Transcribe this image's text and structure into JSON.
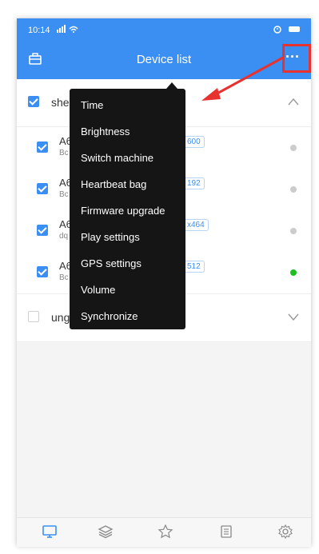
{
  "status_bar": {
    "time": "10:14",
    "signal": "…•••"
  },
  "header": {
    "title": "Device list",
    "more_label": "···"
  },
  "groups": [
    {
      "name": "she",
      "checked": true,
      "expanded": true
    },
    {
      "name": "ung",
      "checked": false,
      "expanded": false
    }
  ],
  "devices": [
    {
      "name": "A6",
      "sub": "Bc",
      "badge": "600",
      "checked": true,
      "online": false
    },
    {
      "name": "A6",
      "sub": "Bc",
      "badge": "192",
      "checked": true,
      "online": false
    },
    {
      "name": "A6",
      "sub": "dq",
      "badge": "x464",
      "checked": true,
      "online": false
    },
    {
      "name": "A6",
      "sub": "Bc",
      "badge": "512",
      "checked": true,
      "online": true
    }
  ],
  "menu": {
    "items": [
      "Time",
      "Brightness",
      "Switch machine",
      "Heartbeat bag",
      "Firmware upgrade",
      "Play settings",
      "GPS settings",
      "Volume",
      "Synchronize"
    ]
  },
  "tabs": [
    {
      "icon": "monitor-icon",
      "active": true
    },
    {
      "icon": "layers-icon",
      "active": false
    },
    {
      "icon": "star-icon",
      "active": false
    },
    {
      "icon": "document-icon",
      "active": false
    },
    {
      "icon": "gear-icon",
      "active": false
    }
  ],
  "colors": {
    "primary": "#3b8ff2",
    "online": "#1ec01e",
    "offline": "#cccccc",
    "annotation": "#e8322f",
    "menu_bg": "#151515"
  }
}
